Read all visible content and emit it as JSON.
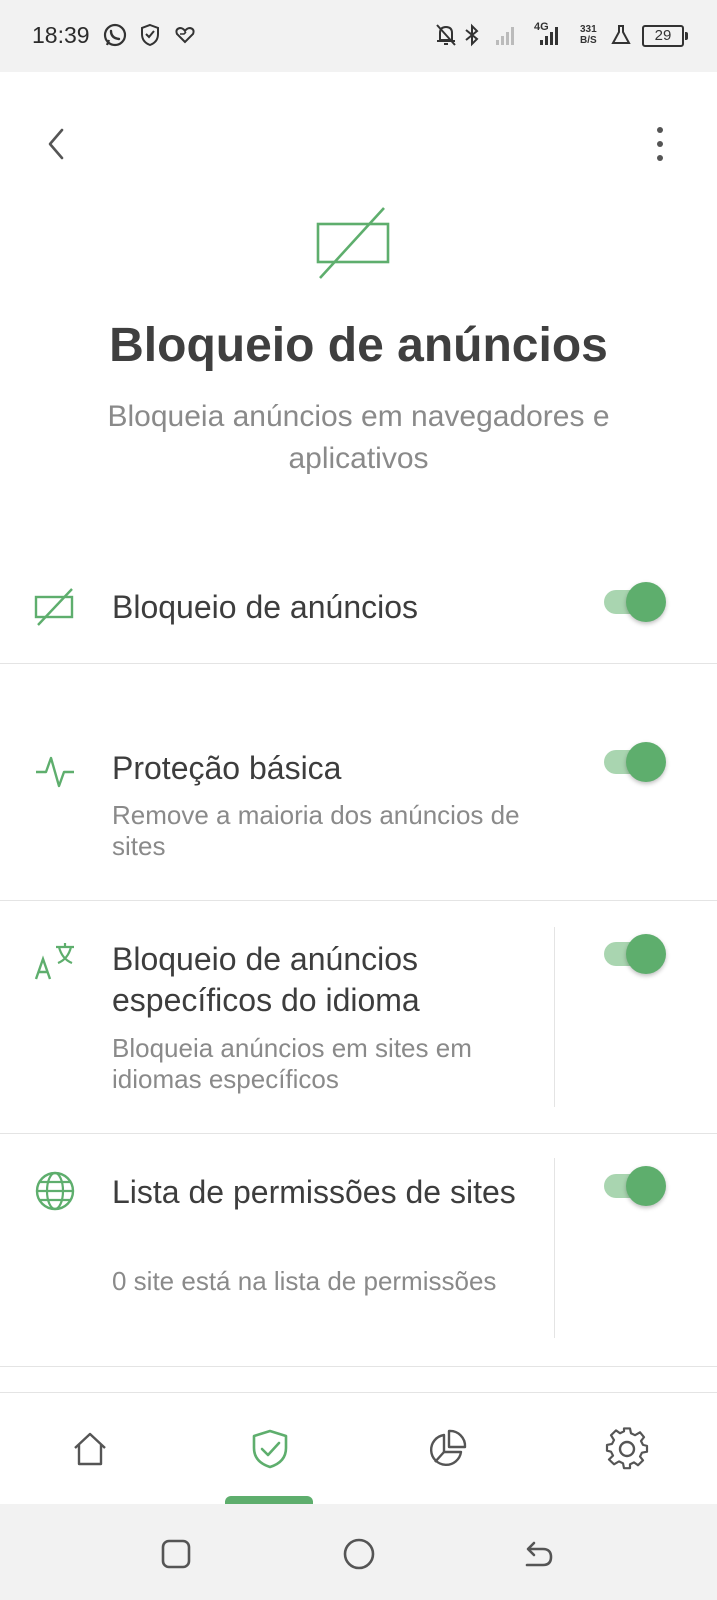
{
  "status_bar": {
    "time": "18:39",
    "network": "4G",
    "speed_value": "331",
    "speed_unit": "B/S",
    "battery": "29"
  },
  "header": {
    "back_icon": "chevron-left-icon",
    "more_icon": "more-vertical-icon"
  },
  "hero": {
    "icon": "ad-block-icon",
    "title": "Bloqueio de anúncios",
    "subtitle": "Bloqueia anúncios em navegadores e aplicativos"
  },
  "settings": [
    {
      "icon": "ad-block-icon",
      "title": "Bloqueio de anúncios",
      "description": "",
      "enabled": true
    },
    {
      "icon": "pulse-icon",
      "title": "Proteção básica",
      "description": "Remove a maioria dos anúncios de sites",
      "enabled": true
    },
    {
      "icon": "translate-icon",
      "title": "Bloqueio de anúncios específicos do idioma",
      "description": "Bloqueia anúncios em sites em idiomas específicos",
      "enabled": true
    },
    {
      "icon": "globe-icon",
      "title": "Lista de permissões de sites",
      "description": "0 site está na lista de permissões",
      "enabled": true
    }
  ],
  "bottom_nav": [
    {
      "icon": "home-icon",
      "active": false
    },
    {
      "icon": "shield-check-icon",
      "active": true
    },
    {
      "icon": "pie-chart-icon",
      "active": false
    },
    {
      "icon": "gear-icon",
      "active": false
    }
  ],
  "colors": {
    "accent": "#5eae6d",
    "accent_light": "#a9d5b0",
    "text_primary": "#3d3d3d",
    "text_secondary": "#8a8a8a",
    "divider": "#e4e4e4",
    "system_bar": "#f2f2f2"
  }
}
